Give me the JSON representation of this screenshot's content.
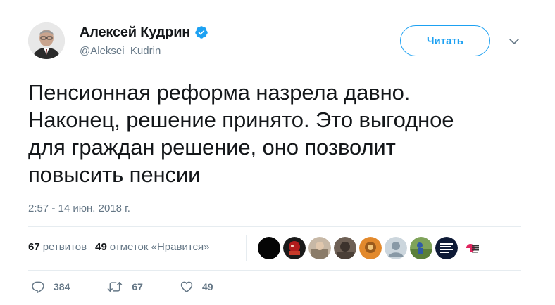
{
  "author": {
    "display_name": "Алексей Кудрин",
    "handle": "@Aleksei_Kudrin",
    "verified": true
  },
  "follow_button": {
    "label": "Читать"
  },
  "more_menu": {
    "icon": "chevron-down-icon"
  },
  "tweet": {
    "text": "Пенсионная реформа назрела давно.\nНаконец, решение принято. Это выгодное\nдля граждан решение, оно позволит\nповысить пенсии",
    "timestamp": "2:57 - 14 июн. 2018 г."
  },
  "stats": {
    "retweets_count": "67",
    "retweets_label": "ретвитов",
    "likes_count": "49",
    "likes_label": "отметок «Нравится»"
  },
  "liker_avatars": [
    {
      "name": "liker-avatar-1"
    },
    {
      "name": "liker-avatar-2"
    },
    {
      "name": "liker-avatar-3"
    },
    {
      "name": "liker-avatar-4"
    },
    {
      "name": "liker-avatar-5"
    },
    {
      "name": "liker-avatar-6"
    },
    {
      "name": "liker-avatar-7"
    },
    {
      "name": "liker-avatar-8"
    },
    {
      "name": "liker-avatar-9"
    }
  ],
  "actions": {
    "reply_count": "384",
    "retweet_count": "67",
    "like_count": "49"
  },
  "colors": {
    "accent": "#1da1f2",
    "text": "#14171a",
    "secondary": "#657786",
    "divider": "#e6ecf0"
  }
}
